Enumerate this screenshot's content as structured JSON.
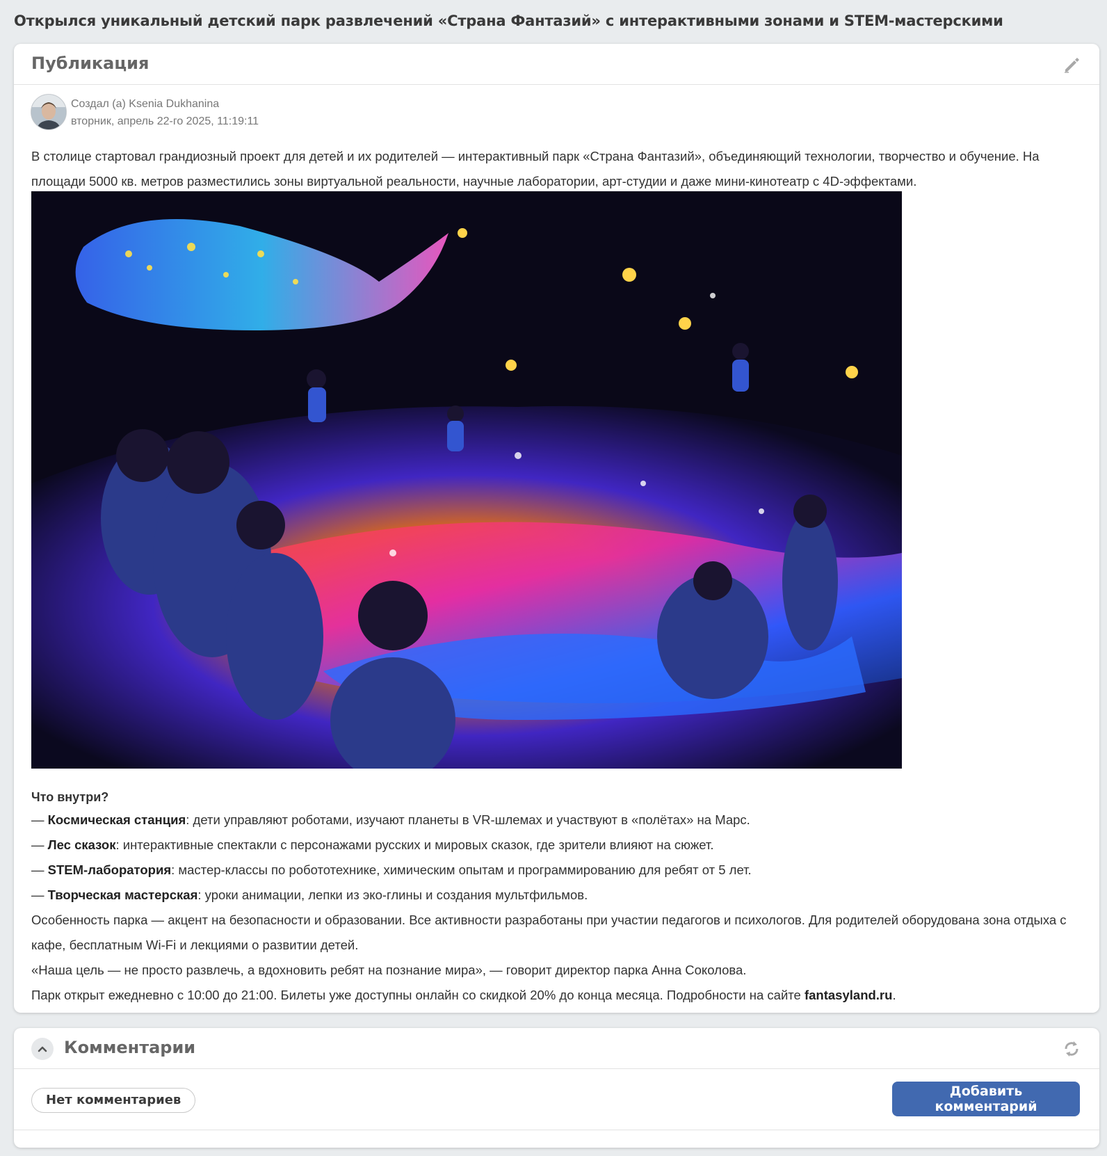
{
  "page": {
    "title": "Открылся уникальный детский парк развлечений «Страна Фантазий» с интерактивными зонами и STEM-мастерскими"
  },
  "post": {
    "header": "Публикация",
    "edit_icon": "pencil-icon",
    "author": {
      "created_by": "Создал (а) Ksenia Dukhanina",
      "date": "вторник, апрель 22-го 2025, 11:19:11"
    },
    "intro": "В столице стартовал грандиозный проект для детей и их родителей — интерактивный парк «Страна Фантазий», объединяющий технологии, творчество и обучение. На площади 5000 кв. метров разместились зоны виртуальной реальности, научные лаборатории, арт-студии и даже мини-кинотеатр с 4D-эффектами.",
    "section_heading": "Что внутри?",
    "zones": [
      {
        "dash": "— ",
        "name": "Космическая станция",
        "text": ": дети управляют роботами, изучают планеты в VR-шлемах и участвуют в «полётах» на Марс."
      },
      {
        "dash": "— ",
        "name": "Лес сказок",
        "text": ": интерактивные спектакли с персонажами русских и мировых сказок, где зрители влияют на сюжет."
      },
      {
        "dash": "— ",
        "name": "STEM-лаборатория",
        "text": ": мастер-классы по робототехнике, химическим опытам и программированию для ребят от 5 лет."
      },
      {
        "dash": "— ",
        "name": "Творческая мастерская",
        "text": ": уроки анимации, лепки из эко-глины и создания мультфильмов."
      }
    ],
    "features": "Особенность парка — акцент на безопасности и образовании. Все активности разработаны при участии педагогов и психологов. Для родителей оборудована зона отдыха с кафе, бесплатным Wi-Fi и лекциями о развитии детей.",
    "quote": "«Наша цель — не просто развлечь, а вдохновить ребят на познание мира», — говорит директор парка Анна Соколова.",
    "closing_text": "Парк открыт ежедневно с 10:00 до 21:00. Билеты уже доступны онлайн со скидкой 20% до конца месяца. Подробности на сайте ",
    "site_link": "fantasyland.ru",
    "closing_end": "."
  },
  "comments": {
    "header": "Комментарии",
    "collapse_icon": "chevron-up-icon",
    "refresh_icon": "refresh-icon",
    "no_comments": "Нет комментариев",
    "add_button": "Добавить комментарий"
  },
  "colors": {
    "page_bg": "#e9ecee",
    "primary_button": "#4169b0"
  }
}
